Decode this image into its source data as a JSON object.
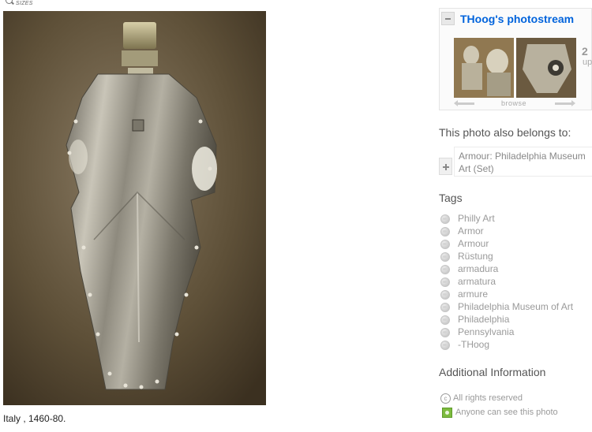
{
  "sizes_link": {
    "label": "SIZES",
    "icon": "magnifier-icon"
  },
  "photo": {
    "caption": "Italy , 1460-80."
  },
  "photostream": {
    "title": "THoog's photostream",
    "count_peek": "2",
    "up_peek": "up",
    "browse_label": "browse"
  },
  "belongs": {
    "heading": "This photo also belongs to:",
    "set_name": "Armour: Philadelphia Museum Art (Set)"
  },
  "tags": {
    "heading": "Tags",
    "items": [
      "Philly Art",
      "Armor",
      "Armour",
      "Rüstung",
      "armadura",
      "armatura",
      "armure",
      "Philadelphia Museum of Art",
      "Philadelphia",
      "Pennsylvania",
      "-THoog"
    ]
  },
  "additional": {
    "heading": "Additional Information",
    "rights": "All rights reserved",
    "privacy": "Anyone can see this photo"
  },
  "colors": {
    "link_blue": "#0063dc",
    "muted_gray": "#9a9a9a",
    "privacy_green": "#7dbb3f"
  }
}
